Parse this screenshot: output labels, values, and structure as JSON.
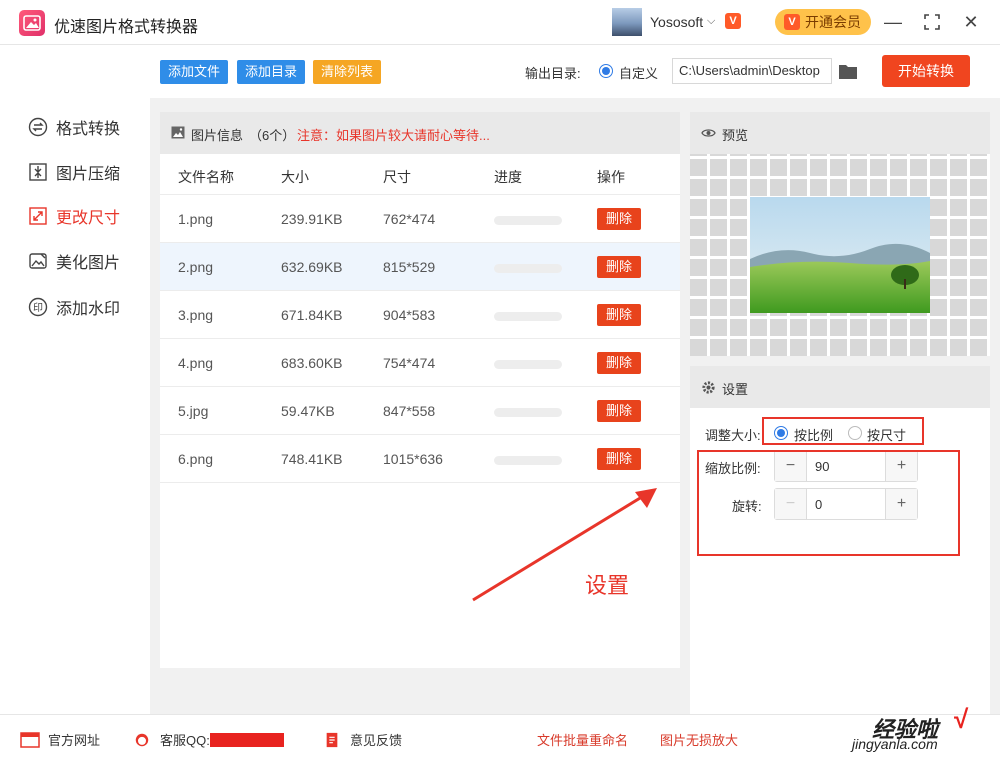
{
  "app": {
    "title": "优速图片格式转换器"
  },
  "user": {
    "name": "Yososoft",
    "vip_label": "开通会员"
  },
  "window": {
    "minimize": "—",
    "maximize": "⛶",
    "close": "✕"
  },
  "sidebar": {
    "items": [
      {
        "label": "格式转换",
        "icon": "format-convert-icon",
        "active": false
      },
      {
        "label": "图片压缩",
        "icon": "compress-icon",
        "active": false
      },
      {
        "label": "更改尺寸",
        "icon": "resize-icon",
        "active": true
      },
      {
        "label": "美化图片",
        "icon": "beautify-icon",
        "active": false
      },
      {
        "label": "添加水印",
        "icon": "watermark-icon",
        "active": false
      }
    ]
  },
  "toolbar": {
    "add_file": "添加文件",
    "add_dir": "添加目录",
    "clear_list": "清除列表",
    "output_label": "输出目录:",
    "output_option": "自定义",
    "output_path": "C:\\Users\\admin\\Desktop",
    "start_button": "开始转换"
  },
  "file_panel": {
    "title": "图片信息",
    "count": "（6个）",
    "notice": "注意：如果图片较大请耐心等待...",
    "columns": [
      "文件名称",
      "大小",
      "尺寸",
      "进度",
      "操作"
    ],
    "rows": [
      {
        "name": "1.png",
        "size": "239.91KB",
        "dims": "762*474",
        "progress": 0,
        "action": "删除"
      },
      {
        "name": "2.png",
        "size": "632.69KB",
        "dims": "815*529",
        "progress": 0,
        "action": "删除"
      },
      {
        "name": "3.png",
        "size": "671.84KB",
        "dims": "904*583",
        "progress": 0,
        "action": "删除"
      },
      {
        "name": "4.png",
        "size": "683.60KB",
        "dims": "754*474",
        "progress": 0,
        "action": "删除"
      },
      {
        "name": "5.jpg",
        "size": "59.47KB",
        "dims": "847*558",
        "progress": 0,
        "action": "删除"
      },
      {
        "name": "6.png",
        "size": "748.41KB",
        "dims": "1015*636",
        "progress": 0,
        "action": "删除"
      }
    ],
    "selected_row": 1
  },
  "preview": {
    "title": "预览"
  },
  "settings": {
    "title": "设置",
    "resize_label": "调整大小:",
    "resize_options": [
      "按比例",
      "按尺寸"
    ],
    "resize_selected": "按比例",
    "scale_label": "缩放比例:",
    "scale_value": "90",
    "rotate_label": "旋转:",
    "rotate_value": "0",
    "minus": "−",
    "plus": "+"
  },
  "annotation": {
    "text": "设置"
  },
  "footer": {
    "website": "官方网址",
    "qq": "客服QQ:",
    "feedback": "意见反馈",
    "batch_rename": "文件批量重命名",
    "lossless_enlarge": "图片无损放大"
  },
  "watermark": {
    "main": "经验啦",
    "sub": "jingyanla.com",
    "mark": "√"
  },
  "colors": {
    "accent": "#e8352a",
    "blue": "#2f7be5",
    "orange": "#f5a623",
    "start": "#f0451f"
  }
}
